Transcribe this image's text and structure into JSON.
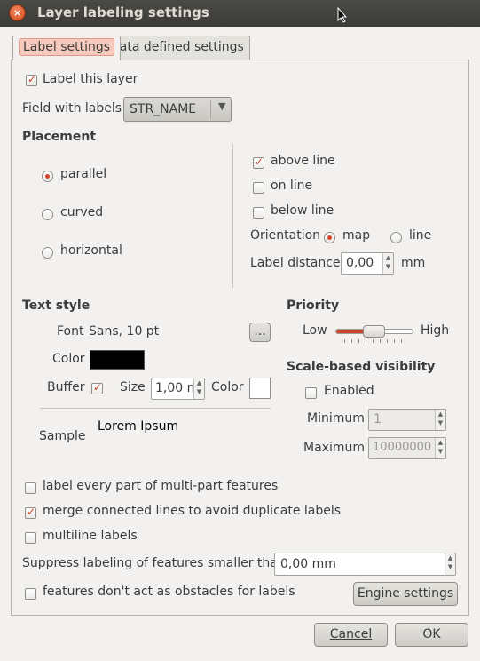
{
  "window": {
    "title": "Layer labeling settings"
  },
  "tabs": [
    {
      "label": "Label settings",
      "active": true
    },
    {
      "label": "Data defined settings",
      "active": false
    }
  ],
  "label_this_layer": {
    "label": "Label this layer",
    "checked": true
  },
  "field": {
    "label": "Field with labels",
    "value": "STR_NAME"
  },
  "placement": {
    "heading": "Placement",
    "modes": [
      {
        "label": "parallel",
        "selected": true
      },
      {
        "label": "curved",
        "selected": false
      },
      {
        "label": "horizontal",
        "selected": false
      }
    ],
    "positions": [
      {
        "label": "above line",
        "checked": true
      },
      {
        "label": "on line",
        "checked": false
      },
      {
        "label": "below line",
        "checked": false
      }
    ],
    "orientation": {
      "label": "Orientation",
      "options": [
        "map",
        "line"
      ],
      "selected": "map"
    },
    "label_distance": {
      "label": "Label distance",
      "value": "0,00",
      "unit": "mm"
    }
  },
  "text_style": {
    "heading": "Text style",
    "font_label": "Font",
    "font_value": "Sans, 10 pt",
    "font_button": "...",
    "color_label": "Color",
    "color_value": "#000000",
    "buffer_label": "Buffer",
    "buffer_checked": true,
    "size_label": "Size",
    "size_value": "1,00 m",
    "buffer_color_label": "Color",
    "buffer_color_value": "#ffffff",
    "sample_label": "Sample",
    "sample_text": "Lorem Ipsum"
  },
  "priority": {
    "heading": "Priority",
    "low": "Low",
    "high": "High",
    "value": 0.5
  },
  "scale_visibility": {
    "heading": "Scale-based visibility",
    "enabled_label": "Enabled",
    "enabled": false,
    "minimum_label": "Minimum",
    "minimum_value": "1",
    "maximum_label": "Maximum",
    "maximum_value": "10000000"
  },
  "options": [
    {
      "label": "label every part of multi-part features",
      "checked": false
    },
    {
      "label": "merge connected lines to avoid duplicate labels",
      "checked": true
    },
    {
      "label": "multiline labels",
      "checked": false
    }
  ],
  "suppress": {
    "label": "Suppress labeling of features smaller than",
    "value": "0,00 mm"
  },
  "obstacles": {
    "label": "features don't act as obstacles for labels",
    "checked": false
  },
  "engine_button": "Engine settings",
  "footer": {
    "cancel": "Cancel",
    "ok": "OK"
  },
  "colors": {
    "accent": "#d0452a",
    "titlebar": "#3c3b37"
  }
}
